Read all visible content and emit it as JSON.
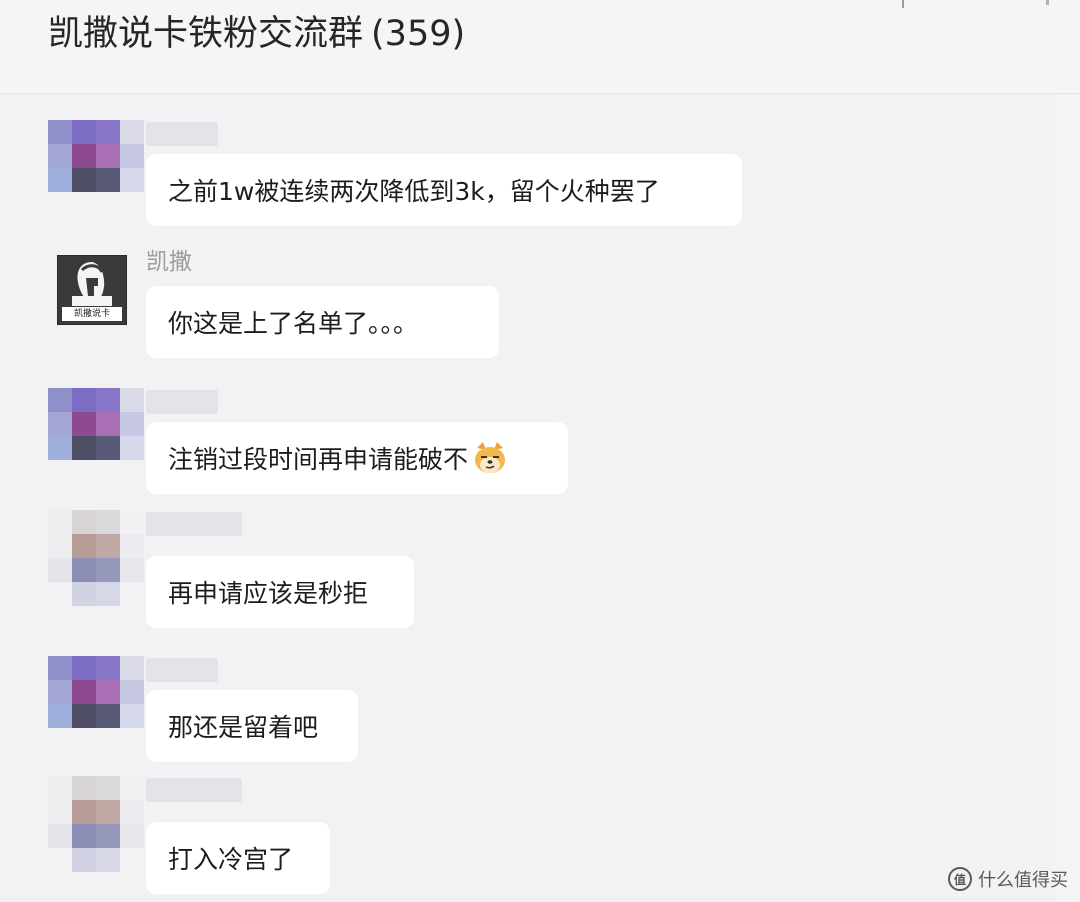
{
  "header": {
    "title": "凯撒说卡铁粉交流群",
    "member_count": "(359)"
  },
  "messages": [
    {
      "sender_name": "",
      "text": "之前1w被连续两次降低到3k，留个火种罢了"
    },
    {
      "sender_name": "凯撒",
      "text": "你这是上了名单了。。。",
      "avatar_caption": "凯撒说卡"
    },
    {
      "sender_name": "",
      "text": "注销过段时间再申请能破不",
      "emoji": "doge-emoji-icon"
    },
    {
      "sender_name": "",
      "text": "再申请应该是秒拒"
    },
    {
      "sender_name": "",
      "text": "那还是留着吧"
    },
    {
      "sender_name": "",
      "text": "打入冷宫了"
    }
  ],
  "watermark": {
    "icon_glyph": "值",
    "text": "什么值得买"
  },
  "colors": {
    "background": "#f2f2f5",
    "bubble": "#ffffff",
    "text": "#1d1d1d"
  }
}
